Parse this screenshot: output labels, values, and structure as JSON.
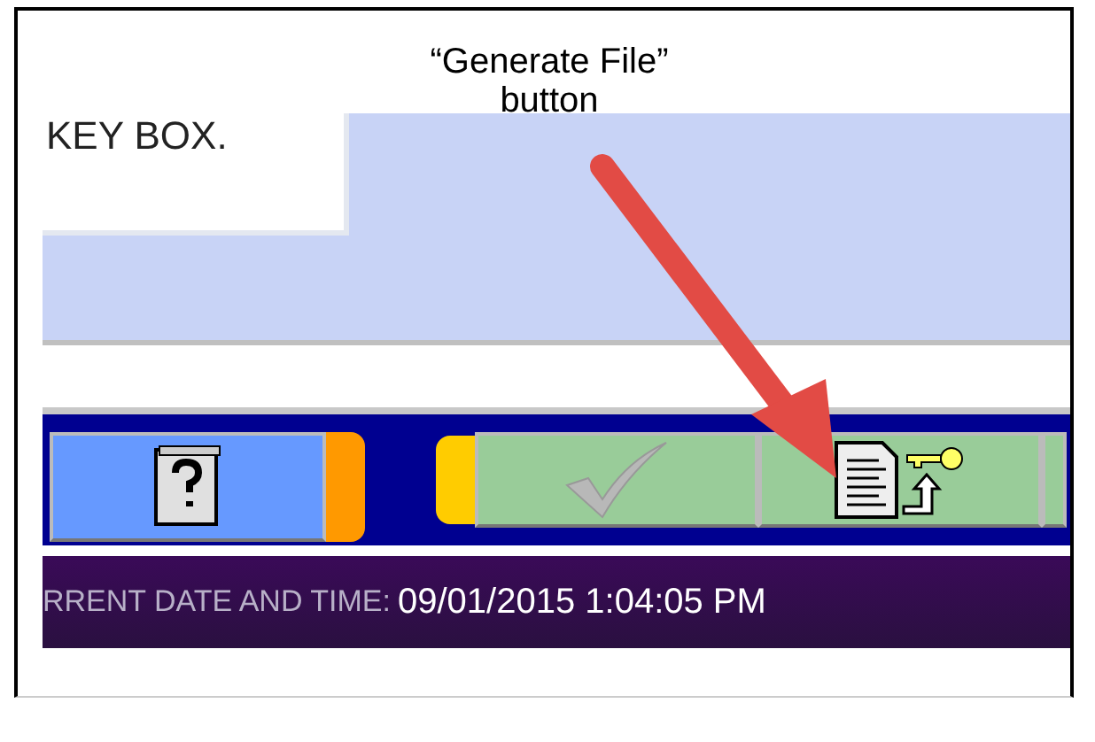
{
  "annotation": {
    "caption_line_1": "“Generate File”",
    "caption_line_2": "button"
  },
  "message_box": {
    "text": "KEY BOX."
  },
  "toolbar": {
    "buttons": [
      {
        "kind": "help"
      },
      {
        "kind": "confirm",
        "disabled": true
      },
      {
        "kind": "generate-file"
      },
      {
        "kind": "blank"
      }
    ]
  },
  "status_bar": {
    "label": "RRENT DATE AND TIME:",
    "value": "09/01/2015 1:04:05 PM"
  }
}
